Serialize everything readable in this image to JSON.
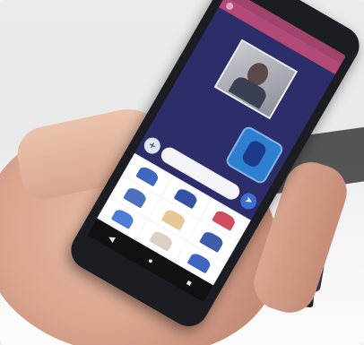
{
  "app": {
    "compose_placeholder": "",
    "stickers": [
      {
        "icon": "sticker-figure-icon",
        "color": "#2b56b8"
      },
      {
        "icon": "sticker-figure-icon",
        "color": "#1e3f99"
      },
      {
        "icon": "sticker-figure-icon",
        "color": "#c93b4f"
      },
      {
        "icon": "sticker-figure-icon",
        "color": "#3b5fb7"
      },
      {
        "icon": "sticker-figure-icon",
        "color": "#e2c28a"
      },
      {
        "icon": "sticker-figure-icon",
        "color": "#2a4a9e"
      },
      {
        "icon": "sticker-figure-icon",
        "color": "#3c6fd0"
      },
      {
        "icon": "sticker-figure-icon",
        "color": "#d9cbbf"
      },
      {
        "icon": "sticker-figure-icon",
        "color": "#2b56b8"
      }
    ],
    "nav": {
      "back": "◀",
      "home": "●",
      "recents": "■"
    },
    "compose_plus": "+",
    "compose_send": "➤"
  }
}
